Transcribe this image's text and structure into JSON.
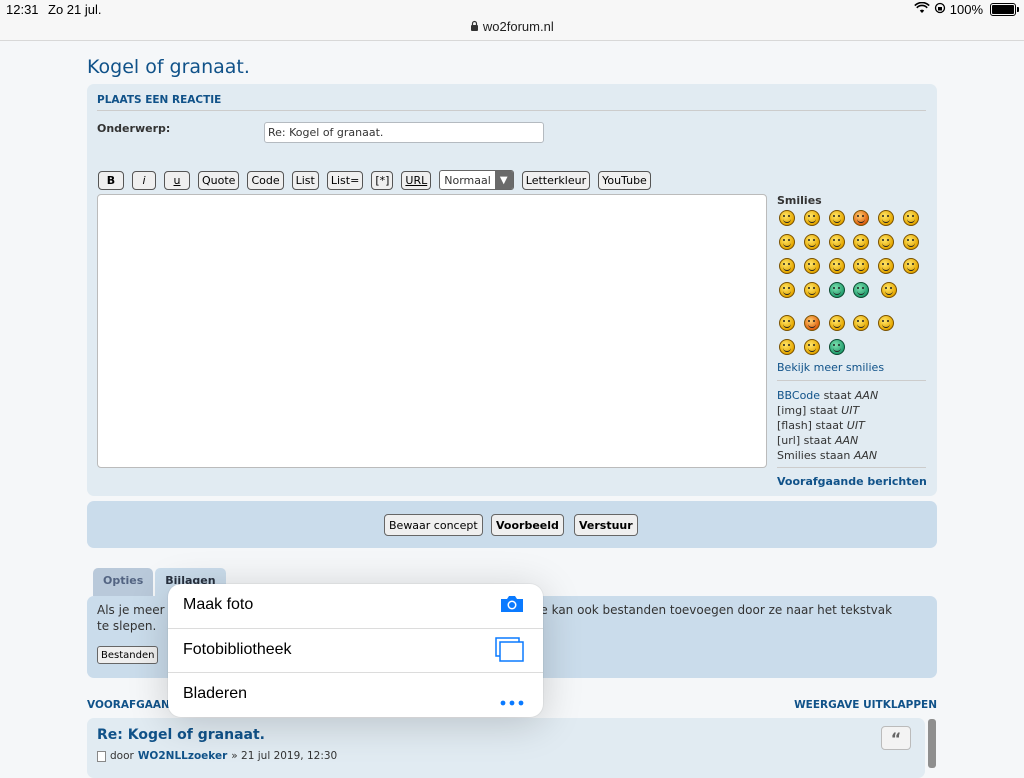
{
  "status_bar": {
    "time": "12:31",
    "date": "Zo 21 jul.",
    "url": "wo2forum.nl",
    "battery": "100%",
    "battery_level": 1.0
  },
  "page": {
    "title": "Kogel of granaat."
  },
  "reply_form": {
    "header": "PLAATS EEN REACTIE",
    "subject_label": "Onderwerp:",
    "subject_value": "Re: Kogel of granaat.",
    "toolbar": {
      "bold": "B",
      "italic": "i",
      "underline": "u",
      "quote": "Quote",
      "code": "Code",
      "list": "List",
      "list_eq": "List=",
      "list_item": "[*]",
      "url": "URL",
      "font_size": "Normaal",
      "font_color": "Letterkleur",
      "youtube": "YouTube"
    },
    "message_value": "",
    "smilies_title": "Smilies",
    "more_smilies": "Bekijk meer smilies",
    "bbcode_status": {
      "bbcode_link": "BBCode",
      "bbcode_text": "staat",
      "bbcode_value": "AAN",
      "img_text": "[img] staat",
      "img_value": "UIT",
      "flash_text": "[flash] staat",
      "flash_value": "UIT",
      "url_text": "[url] staat",
      "url_value": "AAN",
      "smilies_text": "Smilies staan",
      "smilies_value": "AAN"
    },
    "previous_messages_link": "Voorafgaande berichten"
  },
  "actions": {
    "save_draft": "Bewaar concept",
    "preview": "Voorbeeld",
    "submit": "Verstuur"
  },
  "tabs": [
    {
      "label": "Opties",
      "active": false
    },
    {
      "label": "Bijlagen",
      "active": true
    }
  ],
  "attachments": {
    "text_start": "Als je meer",
    "text_end": "r in. Je kan ook bestanden toevoegen door ze naar het tekstvak",
    "text_line2": "te slepen.",
    "button_partial": "Bestanden"
  },
  "previous_section": {
    "left_header": "VOORAFGAANI",
    "right_header": "WEERGAVE UITKLAPPEN"
  },
  "previous_post": {
    "title": "Re: Kogel of granaat.",
    "by": "door",
    "author": "WO2NLLzoeker",
    "date": "» 21 jul 2019, 12:30",
    "quote_icon": "“"
  },
  "popover": {
    "items": [
      {
        "label": "Maak foto",
        "icon": "camera-icon"
      },
      {
        "label": "Fotobibliotheek",
        "icon": "photo-library-icon"
      },
      {
        "label": "Bladeren",
        "icon": "more-dots-icon"
      }
    ],
    "accent": "#0a7aff"
  }
}
